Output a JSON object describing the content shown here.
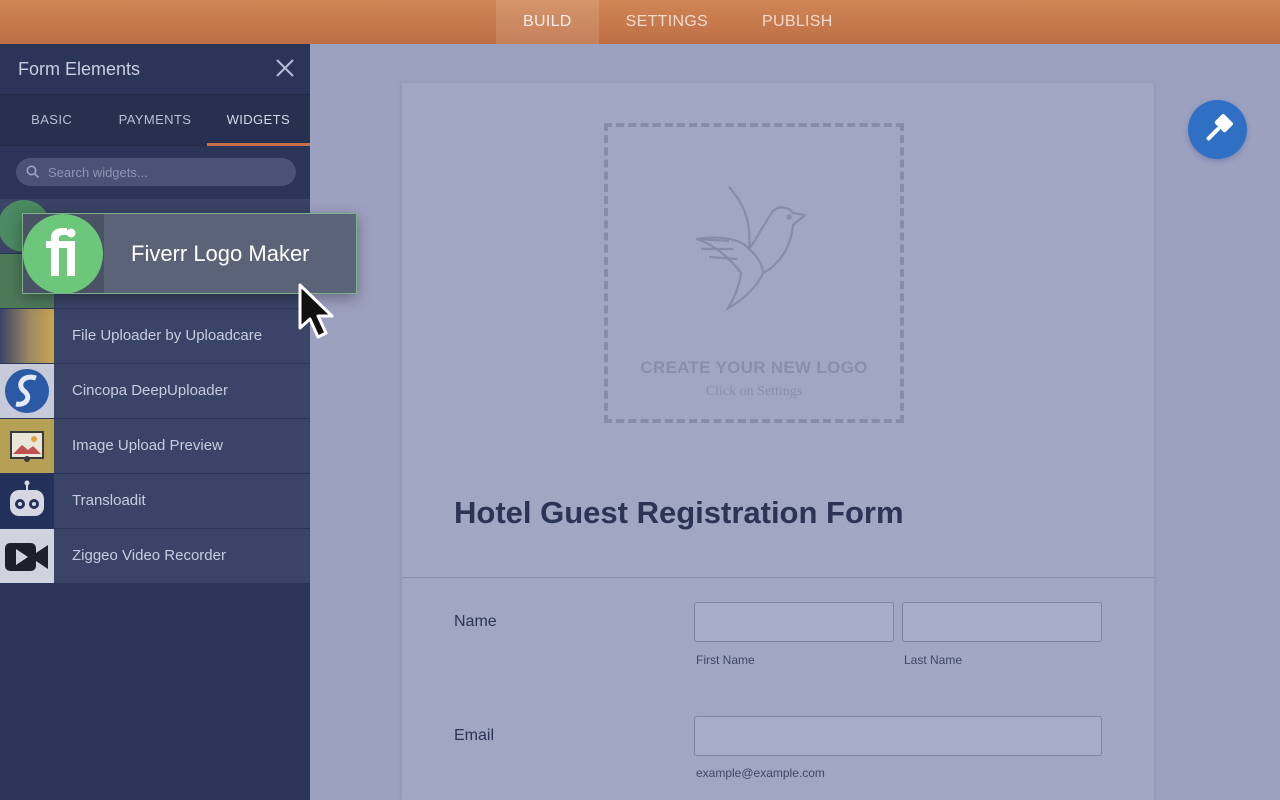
{
  "topnav": {
    "tabs": [
      {
        "label": "BUILD",
        "active": true
      },
      {
        "label": "SETTINGS",
        "active": false
      },
      {
        "label": "PUBLISH",
        "active": false
      }
    ]
  },
  "panel": {
    "title": "Form Elements",
    "tabs": [
      {
        "label": "BASIC",
        "active": false
      },
      {
        "label": "PAYMENTS",
        "active": false
      },
      {
        "label": "WIDGETS",
        "active": true
      }
    ],
    "search_placeholder": "Search widgets...",
    "items": [
      {
        "label": "Fiverr Logo Maker",
        "icon": "fiverr-icon"
      },
      {
        "label": "",
        "icon": "widget-icon"
      },
      {
        "label": "File Uploader by Uploadcare",
        "icon": "uploadcare-icon"
      },
      {
        "label": "Cincopa DeepUploader",
        "icon": "cincopa-icon"
      },
      {
        "label": "Image Upload Preview",
        "icon": "image-upload-icon"
      },
      {
        "label": "Transloadit",
        "icon": "robot-icon"
      },
      {
        "label": "Ziggeo Video Recorder",
        "icon": "video-camera-icon"
      }
    ]
  },
  "drag": {
    "label": "Fiverr Logo Maker",
    "icon": "fiverr-icon"
  },
  "form": {
    "logo_title": "CREATE YOUR NEW LOGO",
    "logo_subtitle": "Click on Settings",
    "title": "Hotel Guest Registration Form",
    "fields": {
      "name_label": "Name",
      "first_name": "First Name",
      "last_name": "Last Name",
      "email_label": "Email",
      "email_hint": "example@example.com"
    }
  },
  "colors": {
    "topbar": "#c8784c",
    "panel": "#2b3558",
    "accent_tab": "#c8704a",
    "fab": "#2f6fc4",
    "fiverr_green": "#6cc77b"
  }
}
